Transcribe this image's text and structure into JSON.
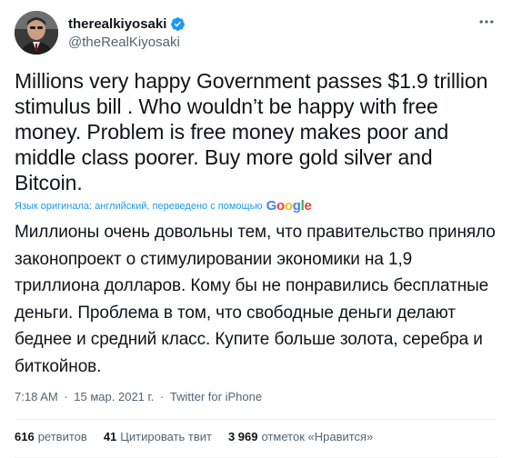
{
  "author": {
    "display_name": "therealkiyosaki",
    "handle": "@theRealKiyosaki",
    "verified": true
  },
  "tweet": {
    "text": "Millions very happy Government passes $1.9 trillion stimulus bill . Who wouldn’t be happy with free money. Problem is free money makes poor and middle class poorer. Buy more gold silver and Bitcoin.",
    "translation_note": "Язык оригинала: английский, переведено с помощью",
    "translation_provider_letters": [
      "G",
      "o",
      "o",
      "g",
      "l",
      "e"
    ],
    "translated_text": "Миллионы очень довольны тем, что правительство приняло законопроект о стимулировании экономики на 1,9 триллиона долларов. Кому бы не понравились бесплатные деньги. Проблема в том, что свободные деньги делают беднее и средний класс. Купите больше золота, серебра и биткойнов."
  },
  "meta": {
    "time": "7:18 AM",
    "date": "15 мар. 2021 г.",
    "source": "Twitter for iPhone",
    "separator": "·"
  },
  "stats": {
    "retweets_count": "616",
    "retweets_label": "ретвитов",
    "quotes_count": "41",
    "quotes_label": "Цитировать твит",
    "likes_count": "3 969",
    "likes_label": "отметок «Нравится»"
  },
  "colors": {
    "text": "#0f1419",
    "secondary": "#536471",
    "accent": "#1d9bf0",
    "divider": "#eff3f4"
  },
  "icons": {
    "verified": "verified-badge-icon",
    "more": "more-dots-icon"
  }
}
